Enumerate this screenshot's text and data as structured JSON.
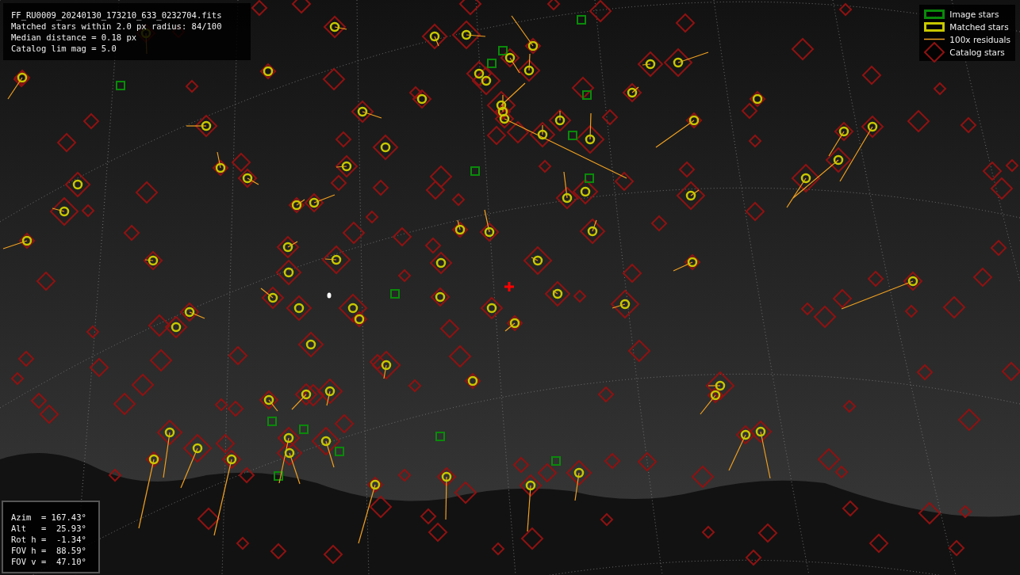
{
  "file_info": {
    "lines": [
      "FF_RU0009_20240130_173210_633_0232704.fits",
      "Matched stars within 2.0 px radius: 84/100",
      "Median distance = 0.18 px",
      "Catalog lim mag = 5.0"
    ]
  },
  "legend": {
    "items": [
      {
        "kind": "image",
        "label": "Image stars"
      },
      {
        "kind": "matched",
        "label": "Matched stars"
      },
      {
        "kind": "residual",
        "label": "100x residuals"
      },
      {
        "kind": "catalog",
        "label": "Catalog stars"
      }
    ]
  },
  "pointing": {
    "lines": [
      "Azim  = 167.43°",
      "Alt   =  25.93°",
      "Rot h =  -1.34°",
      "FOV h =  88.59°",
      "FOV v =  47.10°"
    ]
  }
}
